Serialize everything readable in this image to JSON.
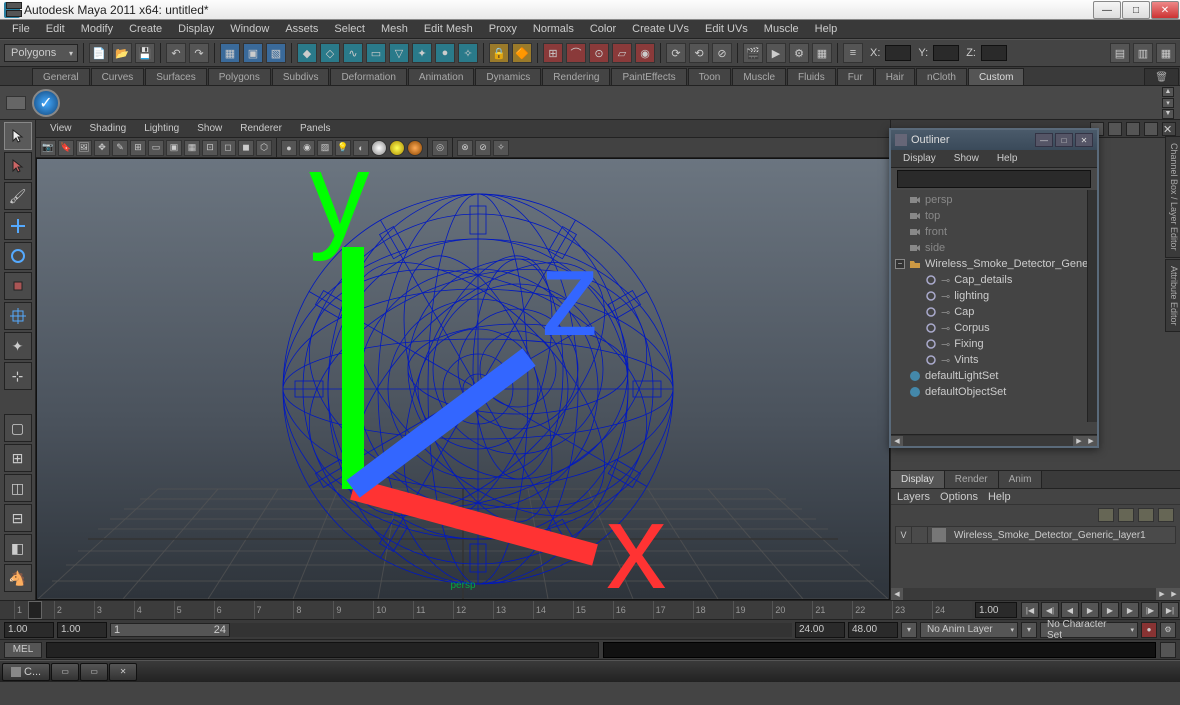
{
  "title": "Autodesk Maya 2011 x64: untitled*",
  "menubar": [
    "File",
    "Edit",
    "Modify",
    "Create",
    "Display",
    "Window",
    "Assets",
    "Select",
    "Mesh",
    "Edit Mesh",
    "Proxy",
    "Normals",
    "Color",
    "Create UVs",
    "Edit UVs",
    "Muscle",
    "Help"
  ],
  "moduleSelector": "Polygons",
  "coords": {
    "x": "X:",
    "y": "Y:",
    "z": "Z:"
  },
  "shelfTabs": [
    "General",
    "Curves",
    "Surfaces",
    "Polygons",
    "Subdivs",
    "Deformation",
    "Animation",
    "Dynamics",
    "Rendering",
    "PaintEffects",
    "Toon",
    "Muscle",
    "Fluids",
    "Fur",
    "Hair",
    "nCloth",
    "Custom"
  ],
  "activeShelfTab": "Custom",
  "viewportMenu": [
    "View",
    "Shading",
    "Lighting",
    "Show",
    "Renderer",
    "Panels"
  ],
  "cameraName": "persp",
  "outliner": {
    "title": "Outliner",
    "menu": [
      "Display",
      "Show",
      "Help"
    ],
    "items": [
      {
        "name": "persp",
        "level": 0,
        "dim": true,
        "icon": "cam"
      },
      {
        "name": "top",
        "level": 0,
        "dim": true,
        "icon": "cam"
      },
      {
        "name": "front",
        "level": 0,
        "dim": true,
        "icon": "cam"
      },
      {
        "name": "side",
        "level": 0,
        "dim": true,
        "icon": "cam"
      },
      {
        "name": "Wireless_Smoke_Detector_Generic",
        "level": 0,
        "dim": false,
        "icon": "grp",
        "exp": true
      },
      {
        "name": "Cap_details",
        "level": 1,
        "dim": false,
        "icon": "mesh"
      },
      {
        "name": "lighting",
        "level": 1,
        "dim": false,
        "icon": "mesh"
      },
      {
        "name": "Cap",
        "level": 1,
        "dim": false,
        "icon": "mesh"
      },
      {
        "name": "Corpus",
        "level": 1,
        "dim": false,
        "icon": "mesh"
      },
      {
        "name": "Fixing",
        "level": 1,
        "dim": false,
        "icon": "mesh"
      },
      {
        "name": "Vints",
        "level": 1,
        "dim": false,
        "icon": "mesh"
      },
      {
        "name": "defaultLightSet",
        "level": 0,
        "dim": false,
        "icon": "set"
      },
      {
        "name": "defaultObjectSet",
        "level": 0,
        "dim": false,
        "icon": "set"
      }
    ]
  },
  "sideTabs": [
    "Channel Box / Layer Editor",
    "Attribute Editor"
  ],
  "layerTabs": [
    "Display",
    "Render",
    "Anim"
  ],
  "layerMenu": [
    "Layers",
    "Options",
    "Help"
  ],
  "layerRow": {
    "vis": "V",
    "name": "Wireless_Smoke_Detector_Generic_layer1"
  },
  "timeline": {
    "start": "1",
    "ticks": [
      1,
      2,
      3,
      4,
      5,
      6,
      7,
      8,
      9,
      10,
      11,
      12,
      13,
      14,
      15,
      16,
      17,
      18,
      19,
      20,
      21,
      22,
      23,
      24
    ],
    "endBox": "1.00"
  },
  "range": {
    "a": "1.00",
    "b": "1.00",
    "c": "1",
    "d": "24",
    "e": "24.00",
    "f": "48.00",
    "animLayer": "No Anim Layer",
    "charSet": "No Character Set"
  },
  "cmd": {
    "lang": "MEL"
  },
  "taskbarApp": "C..."
}
